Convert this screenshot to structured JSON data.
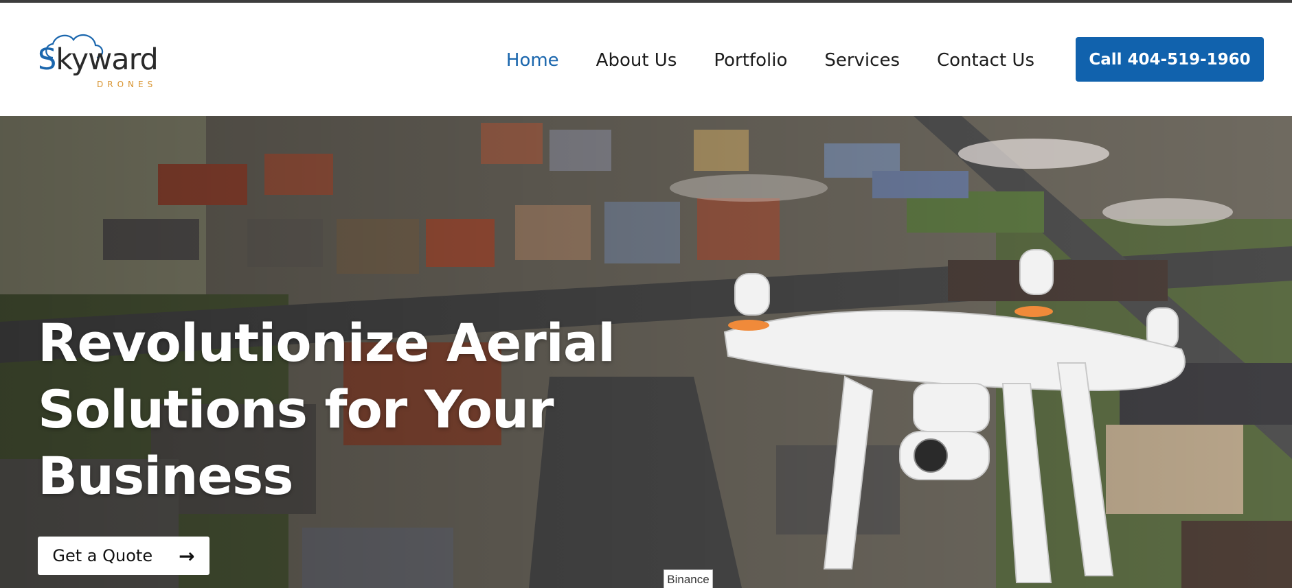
{
  "brand": {
    "name_prefix": "S",
    "name_rest": "kyward",
    "tagline": "DRONES",
    "accent": "#1a66ad",
    "tagline_color": "#d8932f"
  },
  "nav": {
    "items": [
      {
        "label": "Home",
        "active": true
      },
      {
        "label": "About Us",
        "active": false
      },
      {
        "label": "Portfolio",
        "active": false
      },
      {
        "label": "Services",
        "active": false
      },
      {
        "label": "Contact Us",
        "active": false
      }
    ],
    "active_color": "#1a66ad"
  },
  "cta": {
    "call_label": "Call 404-519-1960",
    "color": "#1162ad"
  },
  "hero": {
    "headline": "Revolutionize Aerial Solutions for Your Business",
    "button_label": "Get a Quote",
    "button_icon": "arrow-right-icon",
    "image_description_icon": "aerial-neighborhood-drone-image"
  },
  "tooltip": {
    "label": "Binance"
  }
}
